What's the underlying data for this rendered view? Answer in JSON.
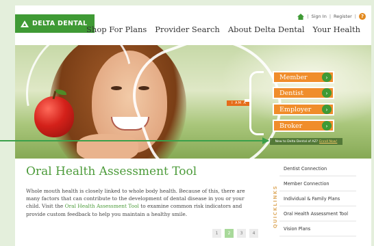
{
  "header": {
    "logo_text": "DELTA DENTAL",
    "util": {
      "sign_in": "Sign In",
      "register": "Register",
      "help": "?"
    },
    "nav": [
      "Shop For Plans",
      "Provider Search",
      "About Delta Dental",
      "Your Health"
    ]
  },
  "hero": {
    "i_am": "I AM A",
    "roles": [
      "Member",
      "Dentist",
      "Employer",
      "Broker"
    ],
    "new_text": "New to Delta Dental of AZ?",
    "enroll": "Enroll Now!"
  },
  "content": {
    "title": "Oral Health Assessment Tool",
    "p1": "Whole mouth health is closely linked to whole body health. Because of this, there are many factors that can contribute to the development of dental disease in you or your child. Visit the",
    "link": "Oral Health Assessment Tool",
    "p2": "to examine common risk indicators and provide custom feedback to help you maintain a healthy smile.",
    "pages": [
      "1",
      "2",
      "3",
      "4"
    ],
    "active_page": "2"
  },
  "quicklinks": {
    "label": "QUICKLINKS",
    "items": [
      "Dentist Connection",
      "Member Connection",
      "Individual & Family Plans",
      "Oral Health Assessment Tool",
      "Vision Plans"
    ]
  },
  "colors": {
    "brand_green": "#3f9a35",
    "orange": "#f08d2b"
  }
}
